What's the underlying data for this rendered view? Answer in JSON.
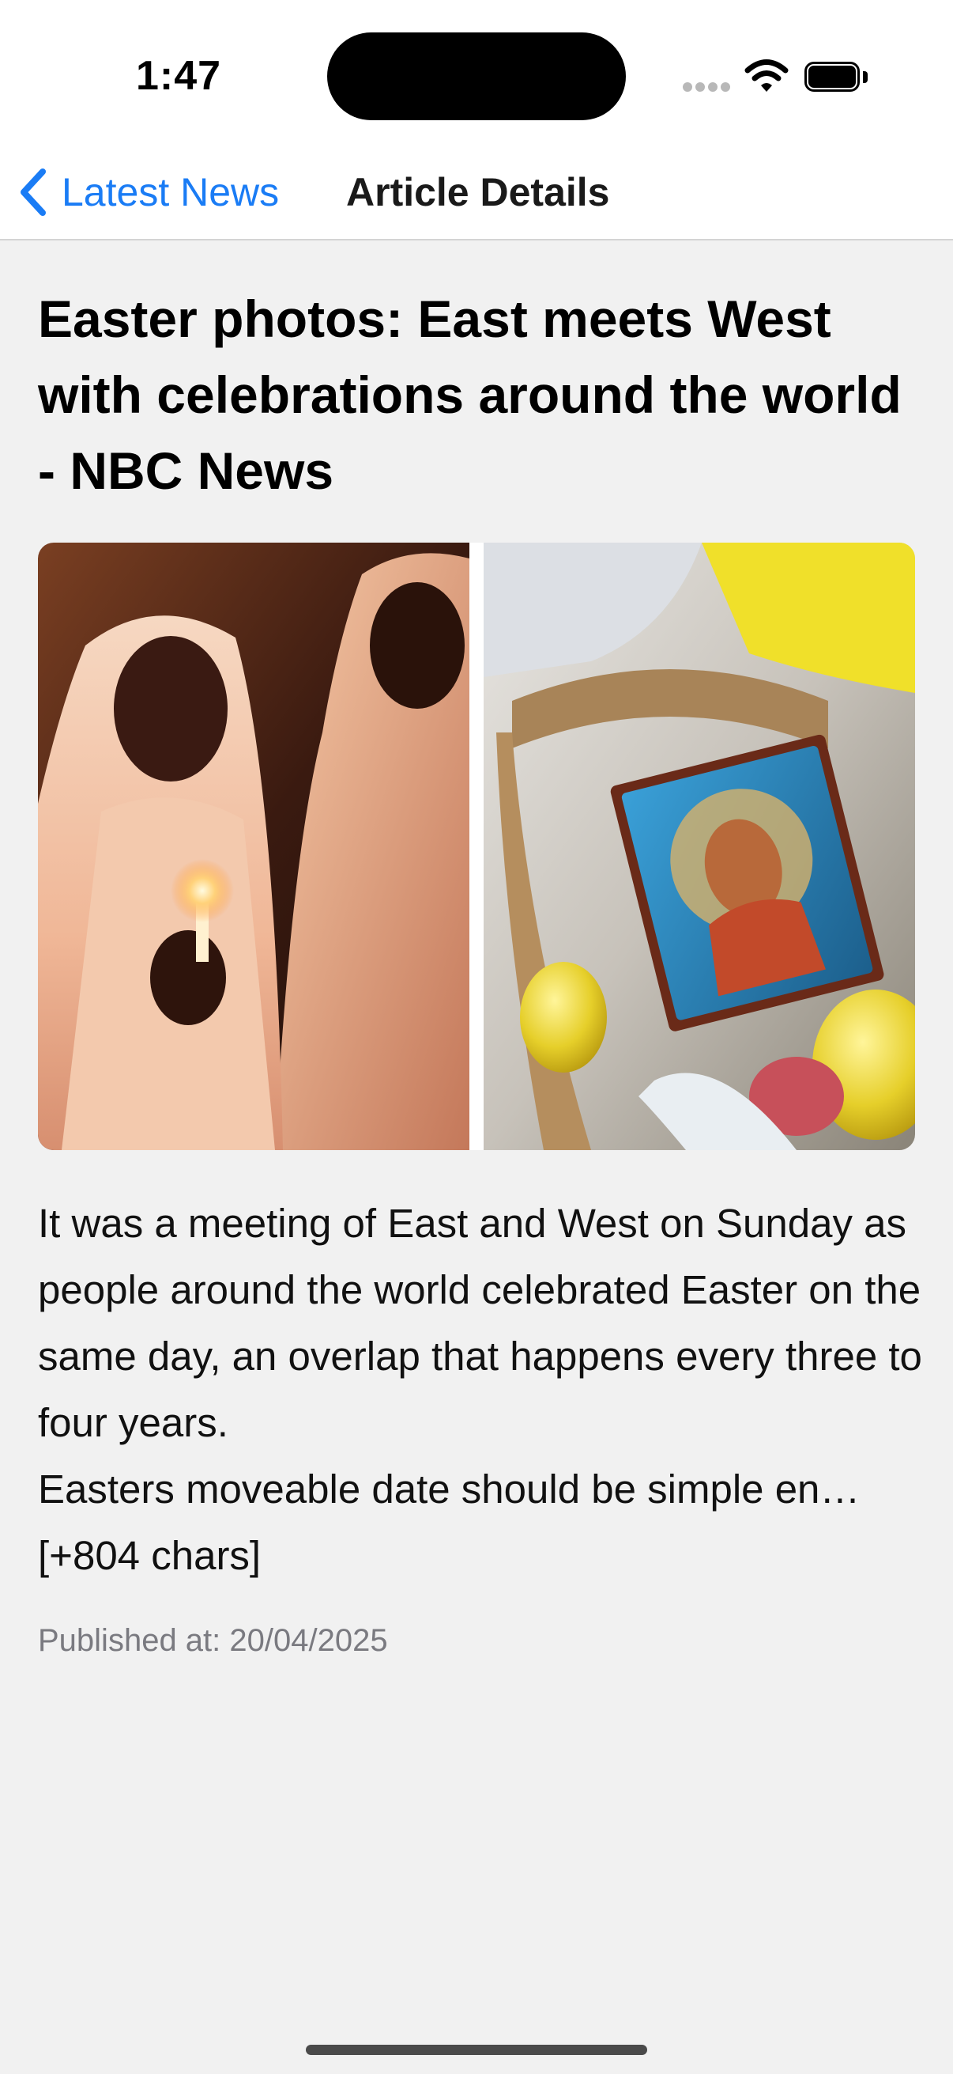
{
  "status_bar": {
    "time": "1:47"
  },
  "nav": {
    "back_label": "Latest News",
    "title": "Article Details"
  },
  "article": {
    "title": "Easter photos: East meets West with celebrations around the world - NBC News",
    "image_alt": "Easter photos: East meets West",
    "body": "It was a meeting of East and West on Sunday as people around the world celebrated Easter on the same day, an overlap that happens every three to four years.\nEasters moveable date should be simple en… [+804 chars]",
    "published": "Published at: 20/04/2025"
  },
  "colors": {
    "accent": "#1a7cf5",
    "background": "#f1f1f1",
    "meta_text": "#7a7a80"
  },
  "icons": [
    "chevron-left-icon",
    "signal-icon",
    "wifi-icon",
    "battery-icon"
  ]
}
